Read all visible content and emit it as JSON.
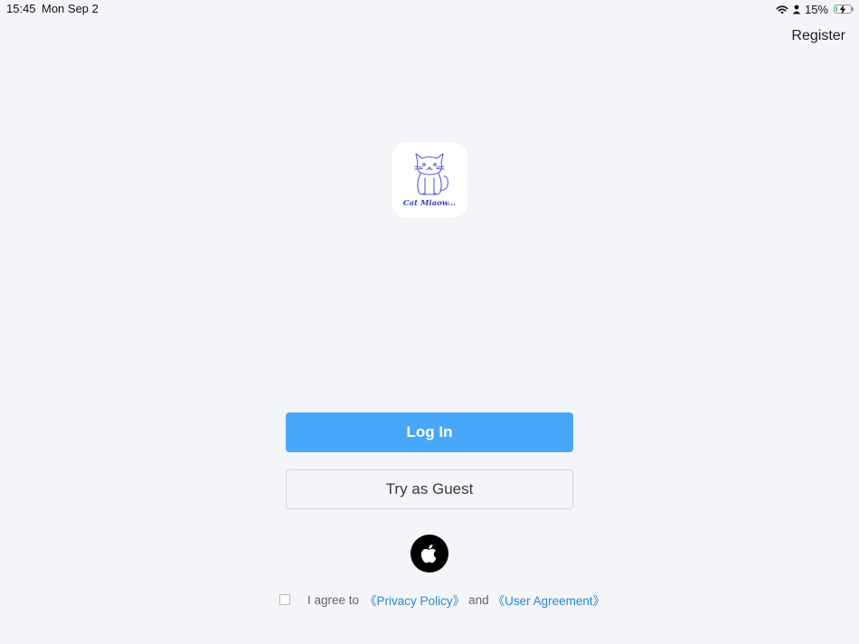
{
  "status_bar": {
    "time": "15:45",
    "date": "Mon Sep 2",
    "battery_percent": "15%",
    "battery_level": 0.15,
    "icons": [
      "wifi-icon",
      "person-icon",
      "battery-charging-icon"
    ]
  },
  "header": {
    "register_label": "Register"
  },
  "logo": {
    "icon": "cat-logo-icon",
    "caption": "Cat Miaow..."
  },
  "actions": {
    "login_label": "Log In",
    "guest_label": "Try as Guest",
    "apple_icon": "apple-icon"
  },
  "agreement": {
    "checked": false,
    "prefix": "I agree to",
    "privacy_link": "《Privacy Policy》",
    "and": "and",
    "terms_link": "《User Agreement》"
  },
  "colors": {
    "background": "#f4f5f9",
    "primary": "#47a8fa",
    "link": "#2b86d8",
    "logo_stroke": "#5b5fe0"
  }
}
